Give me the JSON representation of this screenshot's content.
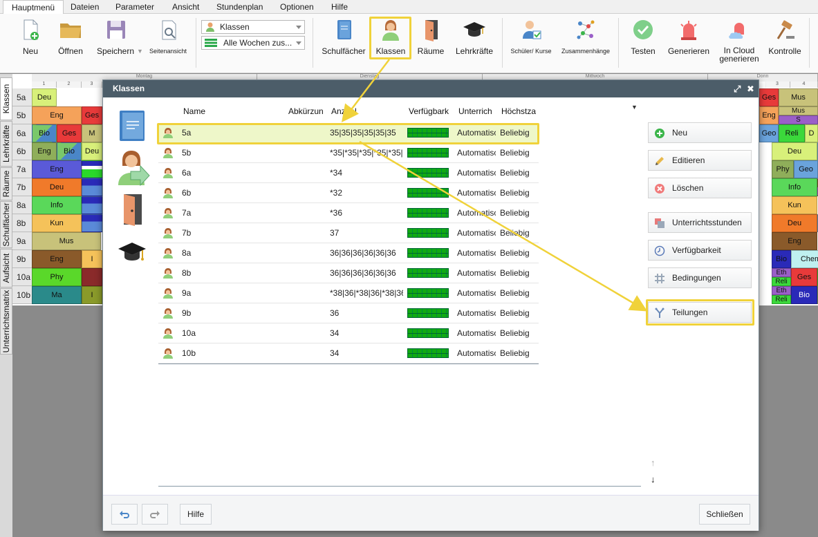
{
  "menu": [
    "Hauptmenü",
    "Dateien",
    "Parameter",
    "Ansicht",
    "Stundenplan",
    "Optionen",
    "Hilfe"
  ],
  "ribbon": {
    "file_buttons": [
      "Neu",
      "Öffnen",
      "Speichern",
      "Seitenansicht"
    ],
    "combo_view": "Klassen",
    "combo_weeks": "Alle Wochen zus...",
    "data_buttons": [
      "Schulfächer",
      "Klassen",
      "Räume",
      "Lehrkräfte"
    ],
    "relation_buttons": [
      "Schüler/ Kurse",
      "Zusammenhänge"
    ],
    "gen_buttons": [
      "Testen",
      "Generieren",
      "In Cloud generieren",
      "Kontrolle"
    ]
  },
  "side_tabs": [
    "Klassen",
    "Lehrkräfte",
    "Räume",
    "Schulfächer",
    "Aufsicht",
    "Unterrichtsmatrix"
  ],
  "timetable": {
    "days": [
      "Montag",
      "Dienstag",
      "Mittwoch",
      "Donn"
    ],
    "slots_left": [
      "1",
      "2",
      "3"
    ],
    "slots_right": [
      "3",
      "4"
    ],
    "classes": [
      "5a",
      "5b",
      "6a",
      "6b",
      "7a",
      "7b",
      "8a",
      "8b",
      "9a",
      "9b",
      "10a",
      "10b"
    ],
    "left_cells": [
      [
        "Deu"
      ],
      [
        "Eng",
        "Ges"
      ],
      [
        "Bio",
        "Ges",
        "M"
      ],
      [
        "Eng",
        "Bio",
        "Deu"
      ],
      [
        "Eng"
      ],
      [
        "Deu"
      ],
      [
        "Info"
      ],
      [
        "Kun"
      ],
      [
        "Mus"
      ],
      [
        "Eng",
        "I"
      ],
      [
        "Phy"
      ],
      [
        "Ma",
        "I"
      ]
    ],
    "right_cells": [
      [
        "Ges",
        "Mus"
      ],
      [
        "Eng",
        "Mus",
        "S"
      ],
      [
        "Geo",
        "Reli",
        "D"
      ],
      [
        "Deu",
        "G"
      ],
      [
        "Phy",
        "Geo",
        "P"
      ],
      [
        "Info",
        "P"
      ],
      [
        "Kun"
      ],
      [
        "Deu",
        "G"
      ],
      [
        "Eng"
      ],
      [
        "Bio",
        "Chem"
      ],
      [
        "Eth",
        "Reli",
        "Ges",
        "E"
      ],
      [
        "Eth",
        "Reli",
        "Bio",
        "G"
      ]
    ]
  },
  "dialog": {
    "title": "Klassen",
    "columns": [
      "Name",
      "Abkürzun",
      "Anzahl",
      "Verfügbark",
      "Unterrich",
      "Höchstza"
    ],
    "rows": [
      {
        "name": "5a",
        "anzahl": "35|35|35|35|35|35",
        "unterricht": "Automatisc",
        "hoechst": "Beliebig"
      },
      {
        "name": "5b",
        "anzahl": "*35|*35|*35|*35|*35|",
        "unterricht": "Automatisc",
        "hoechst": "Beliebig"
      },
      {
        "name": "6a",
        "anzahl": "*34",
        "unterricht": "Automatisc",
        "hoechst": "Beliebig"
      },
      {
        "name": "6b",
        "anzahl": "*32",
        "unterricht": "Automatisc",
        "hoechst": "Beliebig"
      },
      {
        "name": "7a",
        "anzahl": "*36",
        "unterricht": "Automatisc",
        "hoechst": "Beliebig"
      },
      {
        "name": "7b",
        "anzahl": "37",
        "unterricht": "Automatisc",
        "hoechst": "Beliebig"
      },
      {
        "name": "8a",
        "anzahl": "36|36|36|36|36|36",
        "unterricht": "Automatisc",
        "hoechst": "Beliebig"
      },
      {
        "name": "8b",
        "anzahl": "36|36|36|36|36|36",
        "unterricht": "Automatisc",
        "hoechst": "Beliebig"
      },
      {
        "name": "9a",
        "anzahl": "*38|36|*38|36|*38|36",
        "unterricht": "Automatisc",
        "hoechst": "Beliebig"
      },
      {
        "name": "9b",
        "anzahl": "36",
        "unterricht": "Automatisc",
        "hoechst": "Beliebig"
      },
      {
        "name": "10a",
        "anzahl": "34",
        "unterricht": "Automatisc",
        "hoechst": "Beliebig"
      },
      {
        "name": "10b",
        "anzahl": "34",
        "unterricht": "Automatisc",
        "hoechst": "Beliebig"
      }
    ],
    "actions": [
      "Neu",
      "Editieren",
      "Löschen",
      "Unterrichtsstunden",
      "Verfügbarkeit",
      "Bedingungen",
      "Teilungen"
    ],
    "footer": {
      "help": "Hilfe",
      "close": "Schließen"
    }
  },
  "colors": {
    "title_bar": "#4c5d69",
    "highlight": "#f0d23a",
    "selected_row": "#eef7c9"
  }
}
